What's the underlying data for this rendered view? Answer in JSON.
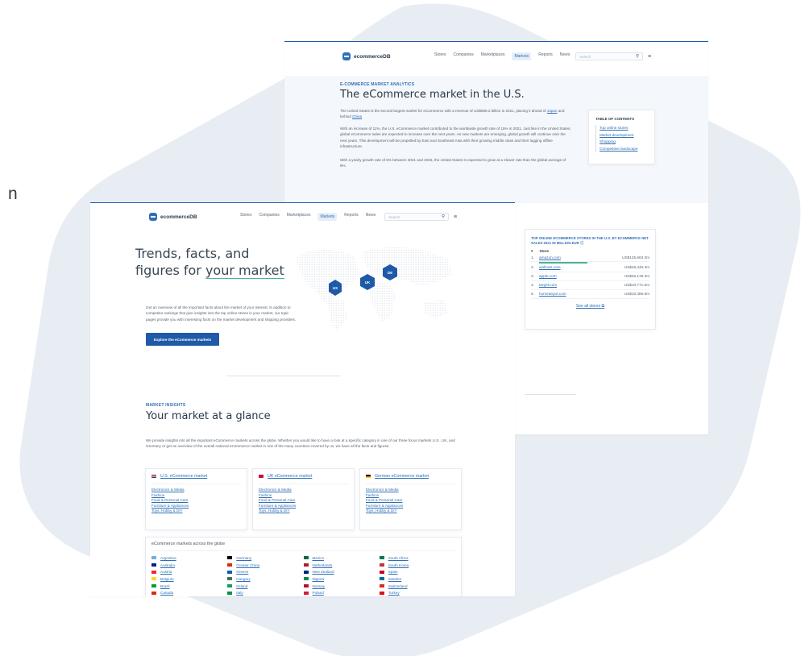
{
  "side_fragment": "n",
  "colors": {
    "brand": "#1e5aa8",
    "accent": "#49b394",
    "link": "#2f6fb6",
    "bg_shape": "#e6ebf2"
  },
  "back_page": {
    "logo_text": "ecommerceDB",
    "nav": [
      "Stores",
      "Companies",
      "Marketplaces",
      "Markets",
      "Reports",
      "News"
    ],
    "nav_active": "Markets",
    "search_placeholder": "Search",
    "eyebrow": "E-COMMERCE MARKET ANALYTICS",
    "title": "The eCommerce market in the U.S.",
    "p1_pre": "The United States is the second largest market for eCommerce with a revenue of US$599.2 billion in 2021, placing it ahead of",
    "p1_link_1": "Japan",
    "p1_mid": "and behind",
    "p1_link_2": "China",
    "p2": "With an increase of 11%, the U.S. eCommerce market contributed to the worldwide growth rate of 15% in 2021. Just like in the United States, global eCommerce sales are expected to increase over the next years. As new markets are emerging, global growth will continue over the next years. This development will be propelled by East and Southeast Asia with their growing middle class and their lagging offline infrastructure.",
    "p3": "With a yearly growth rate of 5% between 2021 and 2025, the United States is expected to grow at a slower rate than the global average of 8%.",
    "toc": {
      "title": "TABLE OF CONTENTS",
      "items": [
        "Top online stores",
        "Market development",
        "Shopping",
        "Competitive landscape"
      ]
    },
    "top_stores": {
      "title": "TOP ONLINE ECOMMERCE STORES IN THE U.S. BY ECOMMERCE NET SALES 2021 IN MILLION EUR",
      "col_rank": "#",
      "col_store": "Store",
      "rows": [
        {
          "rank": "1.",
          "name": "amazon.com",
          "value": "US$125,663.3m"
        },
        {
          "rank": "2.",
          "name": "walmart.com",
          "value": "US$46,446.3m"
        },
        {
          "rank": "3.",
          "name": "apple.com",
          "value": "US$26,135.3m"
        },
        {
          "rank": "4.",
          "name": "target.com",
          "value": "US$10,771.5m"
        },
        {
          "rank": "5.",
          "name": "homedepot.com",
          "value": "US$10,386.8m"
        }
      ],
      "see_all": "See all stores"
    }
  },
  "front_page": {
    "logo_text": "ecommerceDB",
    "nav": [
      "Stores",
      "Companies",
      "Marketplaces",
      "Markets",
      "Reports",
      "News"
    ],
    "nav_active": "Markets",
    "search_placeholder": "Search",
    "headline_line1": "Trends, facts, and",
    "headline_line2_pre": "figures for ",
    "headline_line2_em": "your market",
    "intro": "Get an overview of all the important facts about the market of your interest. In addition to competitor rankings that give insights into the top online stores in your market, our topic pages provide you with interesting facts on the market development and shipping providers.",
    "cta": "Explore the eCommerce markets",
    "map_labels": [
      "US",
      "UK",
      "DE"
    ],
    "eyebrow": "MARKET INSIGHTS",
    "section_title": "Your market at a glance",
    "section_text": "We provide insights into all the important eCommerce markets across the globe. Whether you would like to have a look at a specific category in one of our three focus markets U.S., UK, and Germany or get an overview of the overall national eCommerce market in one of the many countries covered by us, we have all the facts and figures.",
    "markets": [
      {
        "title": "U.S. eCommerce market",
        "categories": [
          "Electronics & Media",
          "Fashion",
          "Food & Personal Care",
          "Furniture & Appliances",
          "Toys, Hobby & DIY"
        ]
      },
      {
        "title": "UK eCommerce market",
        "categories": [
          "Electronics & Media",
          "Fashion",
          "Food & Personal Care",
          "Furniture & Appliances",
          "Toys, Hobby & DIY"
        ]
      },
      {
        "title": "German eCommerce market",
        "categories": [
          "Electronics & Media",
          "Fashion",
          "Food & Personal Care",
          "Furniture & Appliances",
          "Toys, Hobby & DIY"
        ]
      }
    ],
    "globe_title": "eCommerce markets across the globe",
    "countries": [
      "Argentina",
      "Australia",
      "Austria",
      "Belgium",
      "Brazil",
      "Canada",
      "Germany",
      "Greater China",
      "Greece",
      "Hungary",
      "Ireland",
      "Italy",
      "Mexico",
      "Netherlands",
      "New Zealand",
      "Nigeria",
      "Norway",
      "Poland",
      "South Africa",
      "South Korea",
      "Spain",
      "Sweden",
      "Switzerland",
      "Turkey"
    ]
  }
}
